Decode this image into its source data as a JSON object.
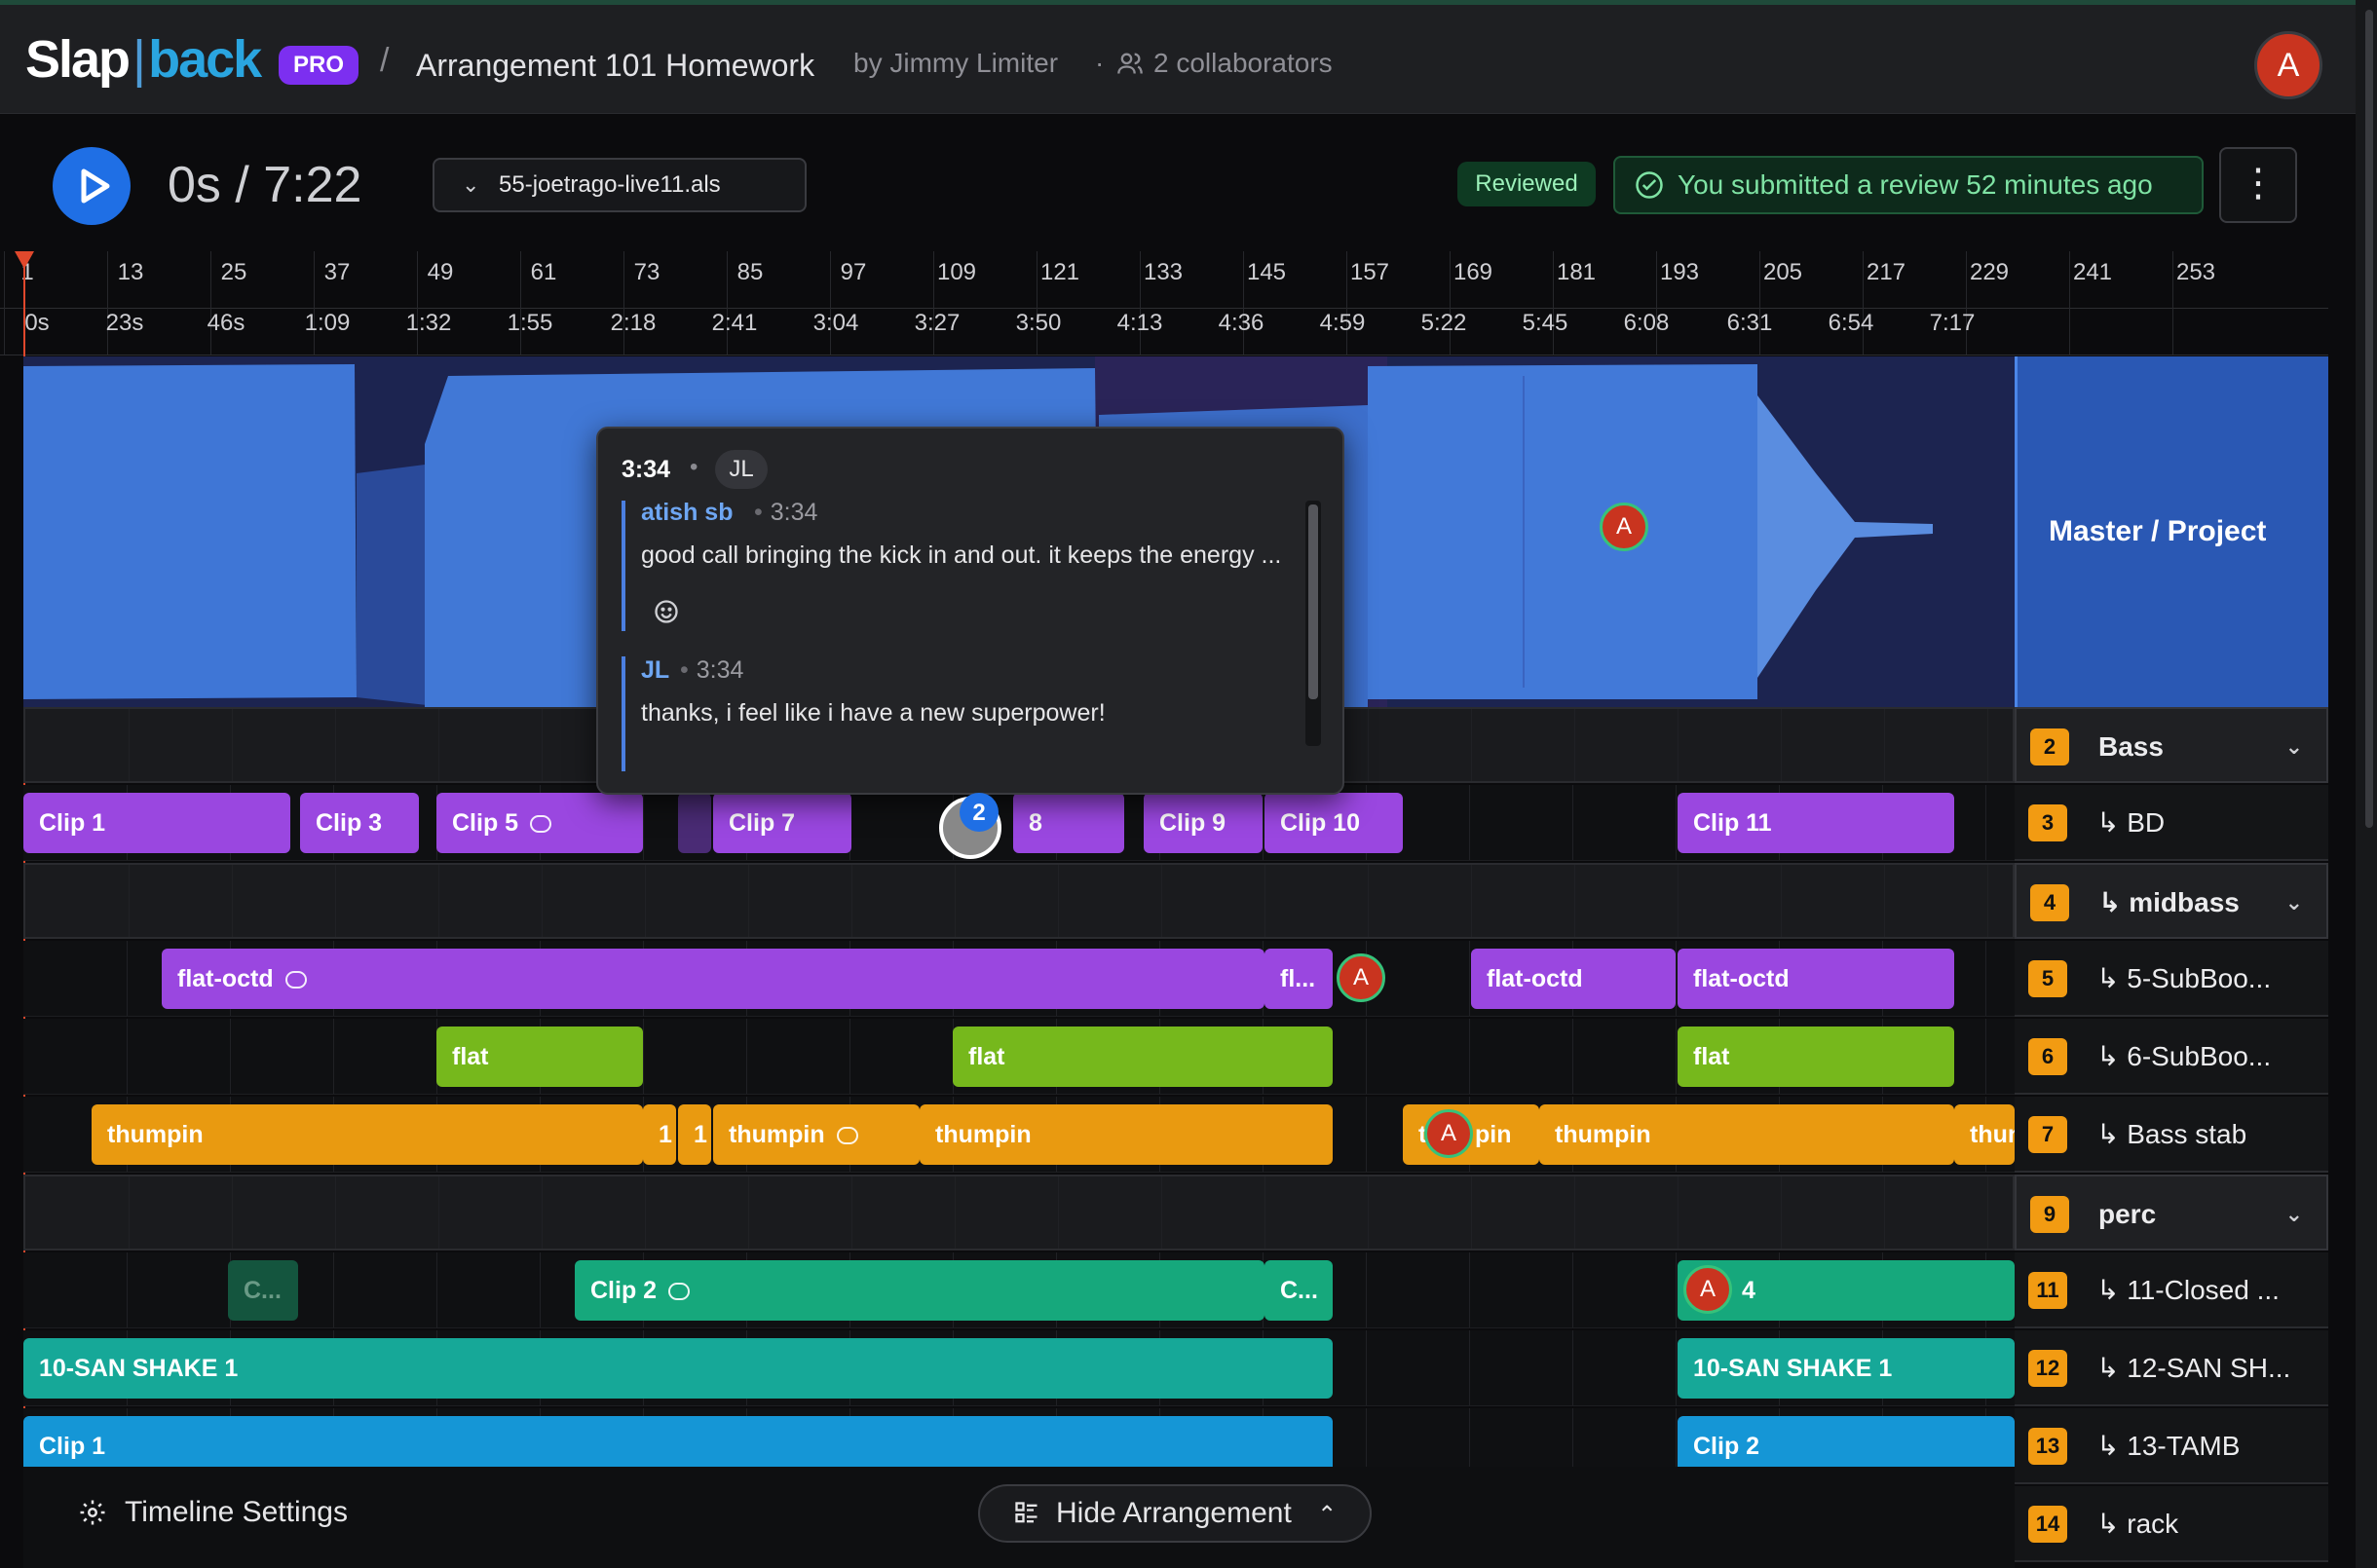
{
  "header": {
    "logo_left": "Slap",
    "logo_sep": "|",
    "logo_right": "back",
    "pro_badge": "PRO",
    "breadcrumb_sep": "/",
    "project_title": "Arrangement 101 Homework",
    "byline": "by Jimmy Limiter",
    "dot": "·",
    "collaborators": "2 collaborators",
    "avatar_initial": "A"
  },
  "transport": {
    "time": "0s / 7:22",
    "file_name": "55-joetrago-live11.als",
    "reviewed_badge": "Reviewed",
    "submitted_text": "You submitted a review 52 minutes ago",
    "more_icon": "⋮"
  },
  "ruler": {
    "bars": [
      "1",
      "13",
      "25",
      "37",
      "49",
      "61",
      "73",
      "85",
      "97",
      "109",
      "121",
      "133",
      "145",
      "157",
      "169",
      "181",
      "193",
      "205",
      "217",
      "229",
      "241",
      "253"
    ],
    "times": [
      "0s",
      "23s",
      "46s",
      "1:09",
      "1:32",
      "1:55",
      "2:18",
      "2:41",
      "3:04",
      "3:27",
      "3:50",
      "4:13",
      "4:36",
      "4:59",
      "5:22",
      "5:45",
      "6:08",
      "6:31",
      "6:54",
      "7:17"
    ]
  },
  "master": {
    "label": "Master / Project",
    "pin_initial": "A"
  },
  "popup": {
    "time": "3:34",
    "dot": "•",
    "initials": "JL",
    "comments": [
      {
        "author": "atish sb",
        "time": "3:34",
        "text": "good call bringing the kick in and out. it keeps the energy ..."
      },
      {
        "author": "JL",
        "time": "3:34",
        "text": "thanks, i feel like i have a new superpower!"
      }
    ],
    "emoji_icon": "smile-icon"
  },
  "tracks": [
    {
      "num": "2",
      "name": "Bass",
      "group": true
    },
    {
      "num": "3",
      "name": "↳ BD",
      "group": false
    },
    {
      "num": "4",
      "name": "↳ midbass",
      "group": true
    },
    {
      "num": "5",
      "name": "↳ 5-SubBoo...",
      "group": false
    },
    {
      "num": "6",
      "name": "↳ 6-SubBoo...",
      "group": false
    },
    {
      "num": "7",
      "name": "↳ Bass stab",
      "group": false
    },
    {
      "num": "9",
      "name": "perc",
      "group": true
    },
    {
      "num": "11",
      "name": "↳ 11-Closed ...",
      "group": false
    },
    {
      "num": "12",
      "name": "↳ 12-SAN SH...",
      "group": false
    },
    {
      "num": "13",
      "name": "↳ 13-TAMB",
      "group": false
    },
    {
      "num": "14",
      "name": "↳ rack",
      "group": false
    }
  ],
  "clips": {
    "bd": [
      "Clip 1",
      "Clip 3",
      "Clip 5",
      "Clip 7",
      "8",
      "Clip 9",
      "Clip 10",
      "Clip 11"
    ],
    "sub5": [
      "flat-octd",
      "fl...",
      "flat-octd",
      "flat-octd"
    ],
    "sub6": [
      "flat",
      "flat",
      "flat"
    ],
    "stab": [
      "thumpin",
      "1",
      "1",
      "thumpin",
      "thumpin",
      "t",
      "pin",
      "thumpin",
      "thun"
    ],
    "closed": [
      "C...",
      "Clip 2",
      "C...",
      "4"
    ],
    "shake": [
      "10-SAN SHAKE 1",
      "10-SAN SHAKE 1"
    ],
    "tamb": [
      "Clip 1",
      "Clip 2"
    ]
  },
  "pins": {
    "a": "A",
    "count": "2"
  },
  "footer": {
    "timeline_settings": "Timeline Settings",
    "hide_arrangement": "Hide Arrangement"
  },
  "colors": {
    "accent_blue": "#1f6fe5",
    "pro_purple": "#7c2ff0",
    "track_num": "#f29b12",
    "review_green": "#7fe3a4",
    "playhead": "#e0482c"
  }
}
